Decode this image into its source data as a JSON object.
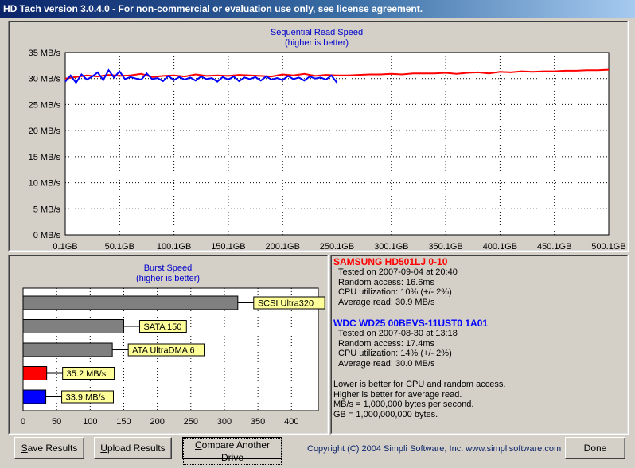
{
  "window": {
    "title": "HD Tach version 3.0.4.0  - For non-commercial or evaluation use only, see license agreement."
  },
  "colors": {
    "drive1": "#ff0000",
    "drive2": "#0000ff",
    "bar_gray": "#808080",
    "label_bg": "#ffff99"
  },
  "read_chart": {
    "title": "Sequential Read Speed",
    "subtitle": "(higher is better)",
    "y_ticks": [
      "0 MB/s",
      "5 MB/s",
      "10 MB/s",
      "15 MB/s",
      "20 MB/s",
      "25 MB/s",
      "30 MB/s",
      "35 MB/s"
    ],
    "x_ticks": [
      "0.1GB",
      "50.1GB",
      "100.1GB",
      "150.1GB",
      "200.1GB",
      "250.1GB",
      "300.1GB",
      "350.1GB",
      "400.1GB",
      "450.1GB",
      "500.1GB"
    ]
  },
  "burst_chart": {
    "title": "Burst Speed",
    "subtitle": "(higher is better)",
    "x_ticks": [
      "0",
      "50",
      "100",
      "150",
      "200",
      "250",
      "300",
      "350",
      "400"
    ],
    "bar_labels": [
      "SCSI Ultra320",
      "SATA 150",
      "ATA UltraDMA 6",
      "35.2 MB/s",
      "33.9 MB/s"
    ]
  },
  "chart_data": [
    {
      "type": "line",
      "title": "Sequential Read Speed",
      "subtitle": "(higher is better)",
      "xlabel": "",
      "ylabel": "",
      "xlim": [
        0.1,
        500.1
      ],
      "ylim": [
        0,
        35
      ],
      "x_unit": "GB",
      "y_unit": "MB/s",
      "grid": true,
      "series": [
        {
          "color": "#ff0000",
          "x": [
            0.1,
            10,
            20,
            30,
            40,
            50,
            60,
            70,
            80,
            90,
            100,
            110,
            120,
            130,
            140,
            150,
            160,
            170,
            180,
            190,
            200,
            210,
            220,
            230,
            240,
            250,
            260,
            270,
            280,
            290,
            300,
            310,
            320,
            330,
            340,
            350,
            360,
            370,
            380,
            390,
            400,
            410,
            420,
            430,
            440,
            450,
            460,
            470,
            480,
            490,
            500.1
          ],
          "y": [
            30.0,
            30.3,
            30.6,
            30.4,
            30.7,
            30.5,
            30.6,
            30.9,
            30.3,
            30.5,
            30.6,
            30.4,
            30.8,
            30.5,
            30.6,
            30.5,
            30.7,
            30.6,
            30.5,
            30.4,
            30.8,
            30.6,
            30.9,
            30.5,
            30.7,
            30.6,
            30.6,
            30.7,
            30.8,
            30.8,
            30.9,
            30.8,
            31.0,
            31.0,
            31.0,
            31.1,
            30.9,
            31.1,
            31.2,
            31.0,
            31.3,
            31.2,
            31.4,
            31.3,
            31.4,
            31.4,
            31.5,
            31.5,
            31.6,
            31.6,
            31.7
          ]
        },
        {
          "color": "#0000ff",
          "x": [
            0.1,
            5,
            10,
            15,
            20,
            25,
            30,
            35,
            40,
            45,
            50,
            55,
            60,
            65,
            70,
            75,
            80,
            85,
            90,
            95,
            100,
            105,
            110,
            115,
            120,
            125,
            130,
            135,
            140,
            145,
            150,
            155,
            160,
            165,
            170,
            175,
            180,
            185,
            190,
            195,
            200,
            205,
            210,
            215,
            220,
            225,
            230,
            235,
            240,
            245,
            250
          ],
          "y": [
            29.4,
            30.6,
            29.2,
            30.8,
            29.8,
            30.4,
            31.2,
            29.7,
            31.6,
            30.2,
            31.4,
            29.9,
            30.3,
            30.0,
            29.8,
            31.0,
            29.9,
            30.1,
            29.5,
            30.5,
            29.7,
            30.3,
            29.8,
            30.2,
            29.6,
            30.4,
            29.9,
            30.1,
            29.4,
            30.3,
            29.8,
            30.4,
            29.5,
            30.2,
            29.9,
            30.3,
            29.6,
            30.4,
            29.8,
            30.1,
            29.7,
            30.5,
            29.9,
            30.2,
            29.6,
            30.4,
            30.0,
            30.2,
            29.8,
            30.6,
            29.2
          ]
        }
      ]
    },
    {
      "type": "bar",
      "title": "Burst Speed",
      "subtitle": "(higher is better)",
      "orientation": "horizontal",
      "categories": [
        "SCSI Ultra320",
        "SATA 150",
        "ATA UltraDMA 6",
        "35.2 MB/s",
        "33.9 MB/s"
      ],
      "values": [
        320,
        150,
        133,
        35.2,
        33.9
      ],
      "colors": [
        "#808080",
        "#808080",
        "#808080",
        "#ff0000",
        "#0000ff"
      ],
      "xlim": [
        0,
        440
      ],
      "grid": true
    }
  ],
  "drives": [
    {
      "name": "SAMSUNG HD501LJ 0-10",
      "tested": "Tested on 2007-09-04 at 20:40",
      "random_access": "Random access: 16.6ms",
      "cpu": "CPU utilization: 10% (+/- 2%)",
      "avg_read": "Average read: 30.9 MB/s"
    },
    {
      "name": "WDC WD25 00BEVS-11UST0 1A01",
      "tested": "Tested on 2007-08-30 at 13:18",
      "random_access": "Random access: 17.4ms",
      "cpu": "CPU utilization: 14% (+/- 2%)",
      "avg_read": "Average read: 30.0 MB/s"
    }
  ],
  "notes": [
    "Lower is better for CPU and random access.",
    "Higher is better for average read.",
    "MB/s = 1,000,000 bytes per second.",
    "GB = 1,000,000,000 bytes."
  ],
  "buttons": {
    "save_u": "S",
    "save_rest": "ave Results",
    "upload_u": "U",
    "upload_rest": "pload Results",
    "compare_u": "C",
    "compare_rest": "ompare Another Drive",
    "done": "Done"
  },
  "footer": {
    "copyright": "Copyright (C) 2004 Simpli Software, Inc. www.simplisoftware.com"
  }
}
